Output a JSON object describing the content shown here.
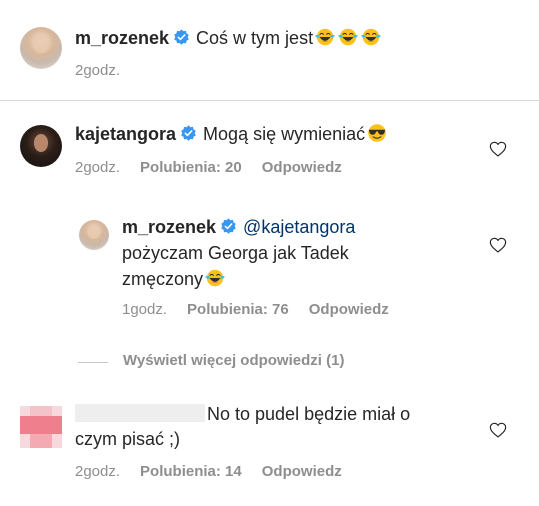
{
  "comments": [
    {
      "username": "m_rozenek",
      "text": "Coś w tym jest",
      "emoji_icons": [
        "face-with-tears-of-joy-icon",
        "face-with-tears-of-joy-icon",
        "face-with-tears-of-joy-icon"
      ],
      "time": "2godz."
    },
    {
      "username": "kajetangora",
      "text": "Mogą się wymieniać",
      "emoji_icons": [
        "smiling-face-with-sunglasses-icon"
      ],
      "time": "2godz.",
      "likes": "Polubienia: 20",
      "reply_label": "Odpowiedz",
      "reply": {
        "username": "m_rozenek",
        "mention": "@kajetangora",
        "text_line1": "pożyczam Georga jak Tadek",
        "text_line2": "zmęczony",
        "emoji_icons": [
          "face-with-tears-of-joy-icon"
        ],
        "time": "1godz.",
        "likes": "Polubienia: 76",
        "reply_label": "Odpowiedz"
      },
      "view_more_replies": "Wyświetl więcej odpowiedzi (1)"
    },
    {
      "username": "",
      "text_line1": "No to pudel będzie miał o",
      "text_line2": "czym pisać ;)",
      "time": "2godz.",
      "likes": "Polubienia: 14",
      "reply_label": "Odpowiedz"
    }
  ],
  "colors": {
    "text": "#262626",
    "secondary": "#8e8e8e",
    "verified": "#3897f0",
    "divider": "#dbdbdb"
  }
}
